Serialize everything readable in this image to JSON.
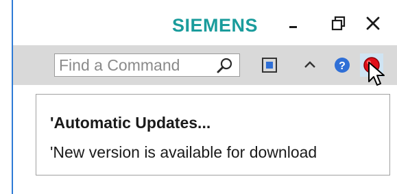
{
  "app": {
    "brand": "SIEMENS",
    "brand_color": "#1a9c9c"
  },
  "window_controls": {
    "minimize": "minimize-icon",
    "restore": "restore-icon",
    "close": "close-icon"
  },
  "toolbar": {
    "search": {
      "placeholder": "Find a Command",
      "value": ""
    },
    "icons": [
      "search-icon",
      "fit-view-icon",
      "collapse-ribbon-icon",
      "help-icon",
      "notification-icon"
    ],
    "help_color": "#2f6fd6",
    "notification_color": "#e0101a"
  },
  "notification": {
    "title": "'Automatic Updates...",
    "message": "'New version is available for download"
  }
}
